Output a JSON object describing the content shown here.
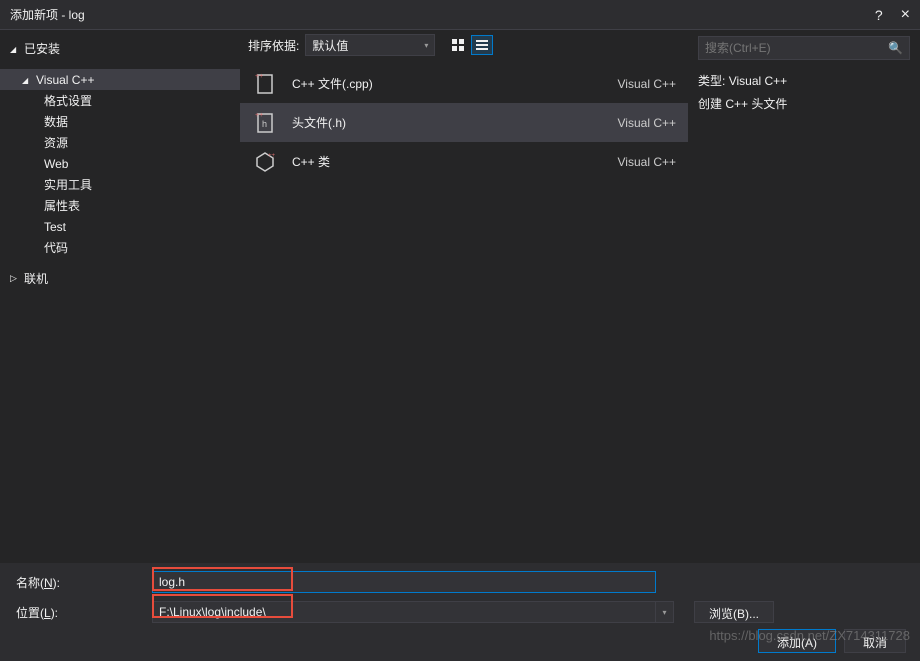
{
  "titlebar": {
    "title": "添加新项 - log",
    "help": "?",
    "close": "×"
  },
  "sidebar": {
    "root": {
      "label": "已安装"
    },
    "cpp": {
      "label": "Visual C++"
    },
    "items": [
      "格式设置",
      "数据",
      "资源",
      "Web",
      "实用工具",
      "属性表",
      "Test",
      "代码"
    ],
    "online": {
      "label": "联机"
    }
  },
  "toolbar": {
    "sort_label": "排序依据:",
    "sort_value": "默认值"
  },
  "templates": [
    {
      "label": "C++ 文件(.cpp)",
      "lang": "Visual C++",
      "icon": "cpp"
    },
    {
      "label": "头文件(.h)",
      "lang": "Visual C++",
      "icon": "h",
      "selected": true
    },
    {
      "label": "C++ 类",
      "lang": "Visual C++",
      "icon": "class"
    }
  ],
  "right": {
    "search_placeholder": "搜索(Ctrl+E)",
    "type_label": "类型:",
    "type_value": "Visual C++",
    "desc": "创建 C++ 头文件"
  },
  "form": {
    "name_label": "名称(",
    "name_key": "N",
    "name_suffix": "):",
    "name_value": "log.h",
    "loc_label": "位置(",
    "loc_key": "L",
    "loc_suffix": "):",
    "loc_value": "F:\\Linux\\log\\include\\",
    "browse": "浏览(B)..."
  },
  "footer": {
    "add": "添加(A)",
    "cancel": "取消"
  },
  "watermark": "https://blog.csdn.net/ZX714311728"
}
